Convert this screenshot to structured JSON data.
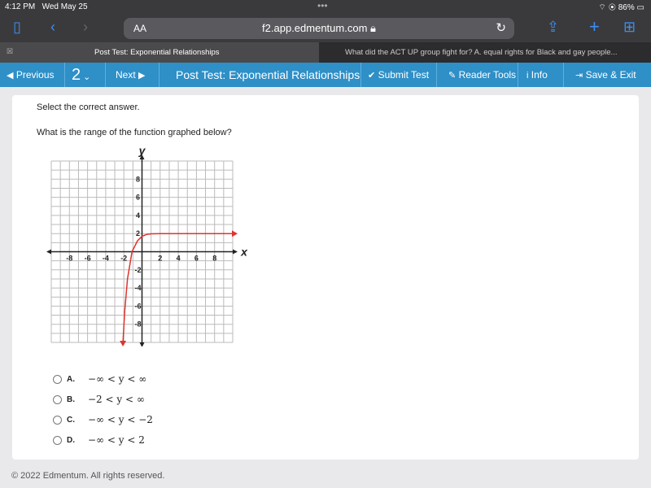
{
  "status": {
    "time": "4:12 PM",
    "date": "Wed May 25",
    "battery": "86%"
  },
  "browser": {
    "text_size": "AA",
    "url": "f2.app.edmentum.com",
    "tabs": [
      {
        "title": "Post Test: Exponential Relationships"
      },
      {
        "title": "What did the ACT UP group fight for? A. equal rights for Black and gay people..."
      }
    ]
  },
  "nav": {
    "previous": "Previous",
    "question_number": "2",
    "next": "Next",
    "title": "Post Test: Exponential Relationships",
    "submit": "Submit Test",
    "reader": "Reader Tools",
    "info": "Info",
    "save": "Save & Exit"
  },
  "question": {
    "instruction": "Select the correct answer.",
    "prompt": "What is the range of the function graphed below?",
    "options": [
      {
        "letter": "A.",
        "text": "−∞ < y < ∞"
      },
      {
        "letter": "B.",
        "text": "−2 < y < ∞"
      },
      {
        "letter": "C.",
        "text": "−∞ < y < −2"
      },
      {
        "letter": "D.",
        "text": "−∞ < y < 2"
      }
    ]
  },
  "chart_data": {
    "type": "line",
    "xlabel": "x",
    "ylabel": "y",
    "xlim": [
      -10,
      10
    ],
    "ylim": [
      -10,
      10
    ],
    "grid": true,
    "xticks": [
      -8,
      -6,
      -4,
      -2,
      2,
      4,
      6,
      8
    ],
    "yticks": [
      8,
      6,
      4,
      2,
      -2,
      -4,
      -6,
      -8
    ],
    "series": [
      {
        "color": "#e0332e",
        "points": [
          [
            -2.1,
            -10
          ],
          [
            -1.9,
            -6.5
          ],
          [
            -1.6,
            -3
          ],
          [
            -1.1,
            0
          ],
          [
            -0.5,
            1.2
          ],
          [
            0,
            1.7
          ],
          [
            0.5,
            1.9
          ],
          [
            1,
            1.97
          ],
          [
            2,
            2
          ],
          [
            10,
            2
          ]
        ]
      }
    ],
    "asymptote": "y = 2"
  },
  "footer": "© 2022 Edmentum. All rights reserved."
}
